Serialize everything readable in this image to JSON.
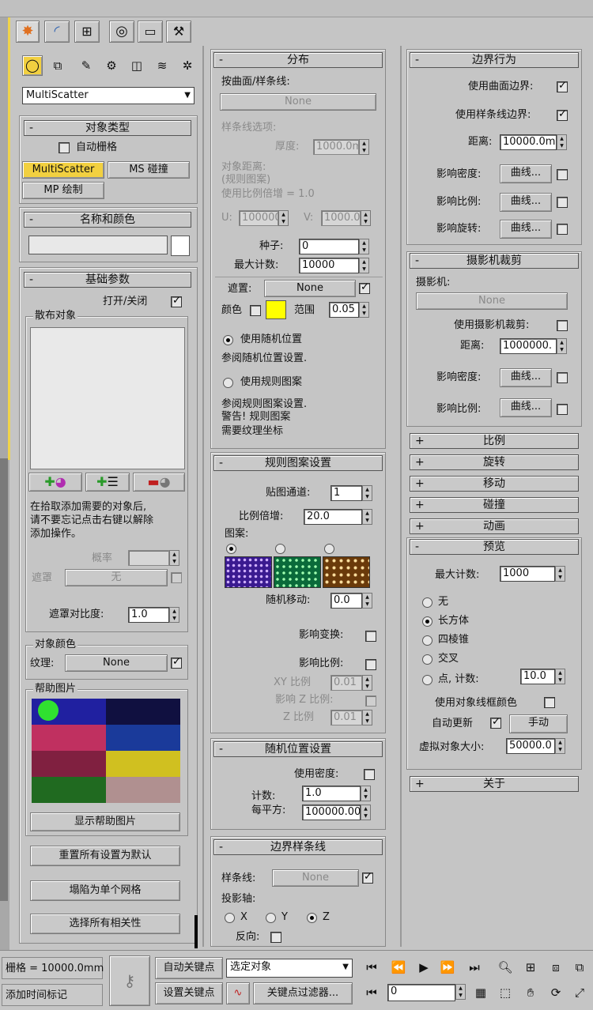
{
  "toolbar": {
    "tab_icons": [
      "create-icon",
      "modify-icon",
      "hierarchy-icon",
      "motion-icon",
      "display-icon",
      "utilities-icon"
    ],
    "sub_icons": [
      "geometry-icon",
      "shapes-icon",
      "lights-icon",
      "cameras-icon",
      "helpers-icon",
      "spacewarps-icon",
      "systems-icon"
    ],
    "category_dropdown": "MultiScatter"
  },
  "left": {
    "object_type": {
      "title": "对象类型",
      "auto_grid": "自动栅格",
      "btn_multiscatter": "MultiScatter",
      "btn_ms_collision": "MS 碰撞",
      "btn_mp_paint": "MP 绘制"
    },
    "name_color": {
      "title": "名称和颜色",
      "name_value": ""
    },
    "basic": {
      "title": "基础参数",
      "on_off": "打开/关闭",
      "scatter_objects": "散布对象",
      "hint": [
        "在拾取添加需要的对象后,",
        "请不要忘记点击右键以解除",
        "添加操作。"
      ],
      "probability": "概率",
      "mask": "遮罩",
      "mask_btn": "无",
      "mask_contrast": "遮罩对比度:",
      "mask_contrast_value": "1.0",
      "object_color": "对象颜色",
      "texture": "纹理:",
      "texture_btn": "None",
      "help_images": "帮助图片",
      "show_help": "显示帮助图片",
      "reset_defaults": "重置所有设置为默认",
      "collapse_mesh": "塌陷为单个网格",
      "select_deps": "选择所有相关性"
    }
  },
  "middle": {
    "distribution": {
      "title": "分布",
      "by_surface": "按曲面/样条线:",
      "surface_btn": "None",
      "spline_opts": "样条线选项:",
      "thickness": "厚度:",
      "thickness_value": "1000.0m",
      "obj_distance": [
        "对象距离:",
        "(规则图案)",
        "使用比例倍增 = 1.0"
      ],
      "u": "U:",
      "u_value": "100000",
      "v": "V:",
      "v_value": "1000.0",
      "seed": "种子:",
      "seed_value": "0",
      "max_count": "最大计数:",
      "max_count_value": "10000",
      "mask": "遮置:",
      "mask_btn": "None",
      "color": "颜色",
      "range": "范围",
      "range_value": "0.05",
      "color_swatch": "#ffff00",
      "use_random": "使用随机位置",
      "random_hint": "参阅随机位置设置.",
      "use_pattern": "使用规则图案",
      "pattern_hint": [
        "参阅规则图案设置.",
        "警告! 规则图案",
        "需要纹理坐标"
      ]
    },
    "pattern": {
      "title": "规则图案设置",
      "map_channel": "贴图通道:",
      "map_channel_value": "1",
      "scale_mult": "比例倍增:",
      "scale_mult_value": "20.0",
      "pattern_label": "图案:",
      "random_move": "随机移动:",
      "random_move_value": "0.0",
      "affect_transform": "影响变换:",
      "affect_scale": "影响比例:",
      "xy_scale": "XY 比例",
      "xy_value": "0.01",
      "affect_z": "影响 Z 比例:",
      "z_scale": "Z 比例",
      "z_value": "0.01"
    },
    "random_pos": {
      "title": "随机位置设置",
      "use_density": "使用密度:",
      "count": "计数:",
      "count_value": "1.0",
      "per_sq": "每平方:",
      "per_sq_value": "100000.00"
    },
    "border_spline": {
      "title": "边界样条线",
      "spline": "样条线:",
      "spline_btn": "None",
      "proj_axis": "投影轴:",
      "x": "X",
      "y": "Y",
      "z": "Z",
      "reverse": "反向:"
    }
  },
  "right": {
    "border": {
      "title": "边界行为",
      "use_surface": "使用曲面边界:",
      "use_spline": "使用样条线边界:",
      "distance": "距离:",
      "distance_value": "10000.0m",
      "affect_density": "影响密度:",
      "affect_scale": "影响比例:",
      "affect_rotation": "影响旋转:",
      "curve": "曲线..."
    },
    "camera": {
      "title": "摄影机裁剪",
      "camera": "摄影机:",
      "camera_btn": "None",
      "use_clip": "使用摄影机裁剪:",
      "distance": "距离:",
      "distance_value": "1000000.",
      "affect_density": "影响密度:",
      "affect_scale": "影响比例:",
      "curve": "曲线..."
    },
    "collapsed": [
      "比例",
      "旋转",
      "移动",
      "碰撞",
      "动画"
    ],
    "preview": {
      "title": "预览",
      "max_count": "最大计数:",
      "max_count_value": "1000",
      "none": "无",
      "box": "长方体",
      "pyramid": "四棱锥",
      "cross": "交叉",
      "points": "点, 计数:",
      "points_value": "10.0",
      "use_bbox_color": "使用对象线框颜色",
      "auto_update": "自动更新",
      "manual": "手动",
      "virtual_size": "虚拟对象大小:",
      "virtual_size_value": "50000.0"
    },
    "about": "关于"
  },
  "statusbar": {
    "grid": "栅格 = 10000.0mm",
    "add_time_tag": "添加时间标记",
    "auto_key": "自动关键点",
    "set_key": "设置关键点",
    "selected": "选定对象",
    "key_filters": "关键点过滤器...",
    "frame": "0"
  }
}
